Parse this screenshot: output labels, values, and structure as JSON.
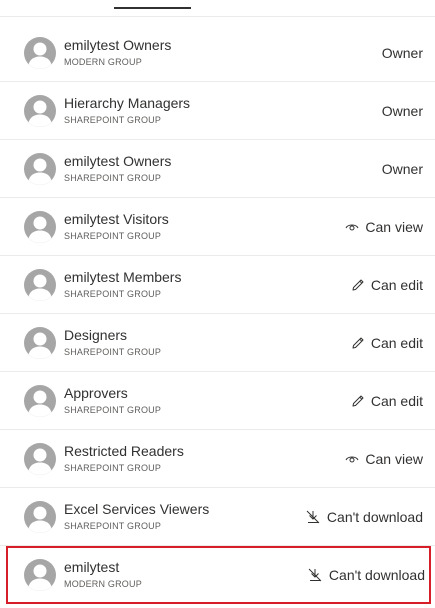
{
  "rows": [
    {
      "name": "emilytest Owners",
      "type": "MODERN GROUP",
      "permission": "Owner",
      "icon": "none"
    },
    {
      "name": "Hierarchy Managers",
      "type": "SHAREPOINT GROUP",
      "permission": "Owner",
      "icon": "none"
    },
    {
      "name": "emilytest Owners",
      "type": "SHAREPOINT GROUP",
      "permission": "Owner",
      "icon": "none"
    },
    {
      "name": "emilytest Visitors",
      "type": "SHAREPOINT GROUP",
      "permission": "Can view",
      "icon": "eye-icon"
    },
    {
      "name": "emilytest Members",
      "type": "SHAREPOINT GROUP",
      "permission": "Can edit",
      "icon": "pencil-icon"
    },
    {
      "name": "Designers",
      "type": "SHAREPOINT GROUP",
      "permission": "Can edit",
      "icon": "pencil-icon"
    },
    {
      "name": "Approvers",
      "type": "SHAREPOINT GROUP",
      "permission": "Can edit",
      "icon": "pencil-icon"
    },
    {
      "name": "Restricted Readers",
      "type": "SHAREPOINT GROUP",
      "permission": "Can view",
      "icon": "eye-icon"
    },
    {
      "name": "Excel Services Viewers",
      "type": "SHAREPOINT GROUP",
      "permission": "Can't download",
      "icon": "no-download-icon"
    },
    {
      "name": "emilytest",
      "type": "MODERN GROUP",
      "permission": "Can't download",
      "icon": "no-download-icon",
      "highlighted": true
    }
  ],
  "colors": {
    "highlight_border": "#d71e28",
    "avatar_bg": "#a6a6a6",
    "divider": "#edebe9"
  }
}
